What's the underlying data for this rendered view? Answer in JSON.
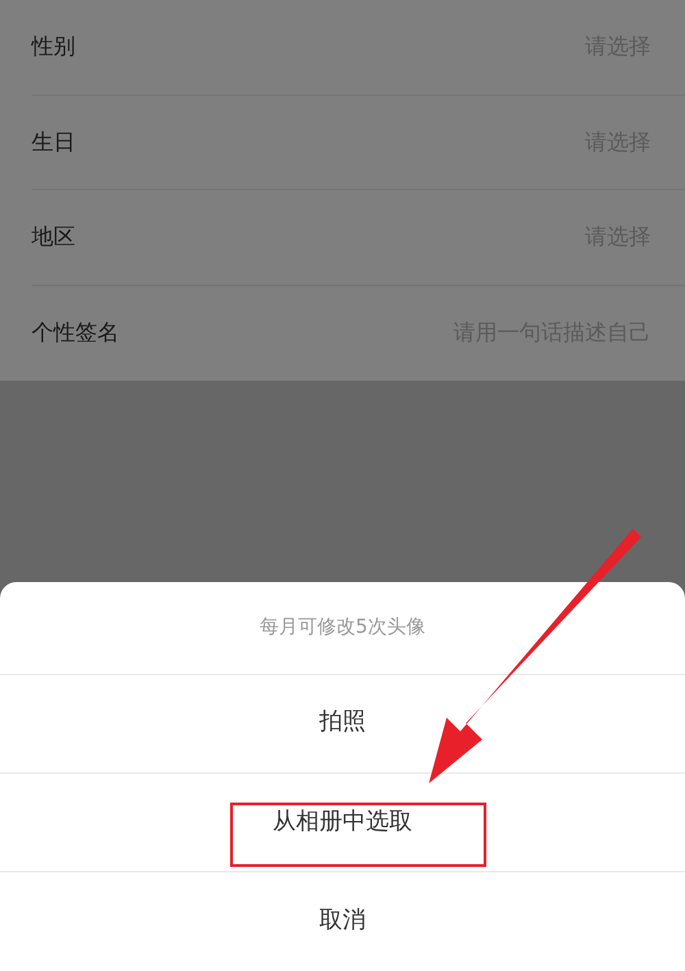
{
  "profile_rows": [
    {
      "label": "性别",
      "placeholder": "请选择"
    },
    {
      "label": "生日",
      "placeholder": "请选择"
    },
    {
      "label": "地区",
      "placeholder": "请选择"
    },
    {
      "label": "个性签名",
      "placeholder": "请用一句话描述自己"
    }
  ],
  "action_sheet": {
    "title": "每月可修改5次头像",
    "options": [
      {
        "label": "拍照",
        "highlighted": false
      },
      {
        "label": "从相册中选取",
        "highlighted": true
      },
      {
        "label": "取消",
        "highlighted": false
      }
    ]
  }
}
